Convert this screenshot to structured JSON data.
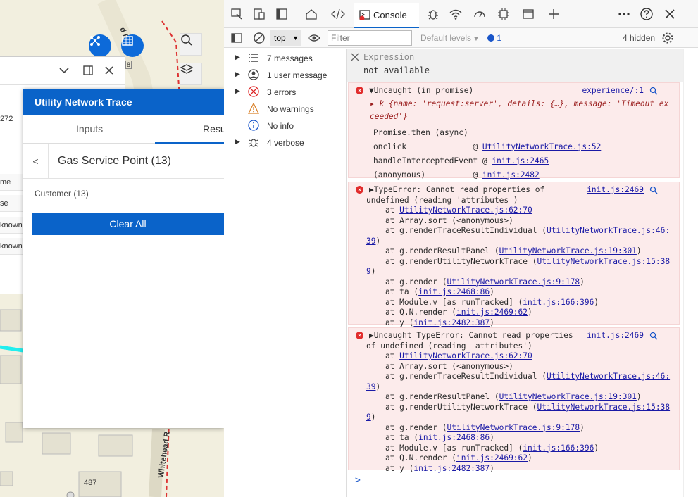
{
  "map": {
    "road_label": "d Rd",
    "road_label2": "Whitehead R",
    "parcel_label": "487",
    "house_num": "8",
    "panel_cells": [
      "272",
      "me",
      "se",
      "known",
      "known"
    ]
  },
  "trace_panel": {
    "title": "Utility Network Trace",
    "tabs": [
      "Inputs",
      "Resu"
    ],
    "back_label": "<",
    "group_title": "Gas Service Point (13)",
    "customer_label": "Customer (13)",
    "clear_all": "Clear All"
  },
  "devtools": {
    "console_tab_label": "Console",
    "context_select": "top",
    "filter_placeholder": "Filter",
    "levels": "Default levels",
    "issues_count": "1",
    "hidden": "4 hidden",
    "sidebar": [
      {
        "icon": "list-icon",
        "label": "7 messages",
        "expander": true
      },
      {
        "icon": "user-icon",
        "label": "1 user message",
        "expander": true
      },
      {
        "icon": "error-icon",
        "label": "3 errors",
        "expander": true
      },
      {
        "icon": "warning-icon",
        "label": "No warnings",
        "expander": false
      },
      {
        "icon": "info-icon",
        "label": "No info",
        "expander": false
      },
      {
        "icon": "bug-icon",
        "label": "4 verbose",
        "expander": true
      }
    ],
    "expression": {
      "label": "Expression",
      "value": "not available"
    },
    "errors": [
      {
        "lines": [
          {
            "t": "▼Uncaught (in promise)",
            "src": "experience/:1"
          },
          {
            "t": "▸ k {name: 'request:server', details: {…}, message: 'Timeout ex",
            "it": true
          },
          {
            "t": "ceeded'}",
            "it": true
          },
          {
            "t": "Promise.then (async)"
          },
          {
            "t": "onclick              @ ",
            "link": "UtilityNetworkTrace.js:52"
          },
          {
            "t": "handleInterceptedEvent @ ",
            "link": "init.js:2465"
          },
          {
            "t": "(anonymous)          @ ",
            "link": "init.js:2482"
          }
        ]
      },
      {
        "lines": [
          {
            "t": "▶TypeError: Cannot read properties of",
            "src": "init.js:2469"
          },
          {
            "t": "undefined (reading 'attributes')"
          },
          {
            "t": "    at ",
            "link": "UtilityNetworkTrace.js:62:70"
          },
          {
            "t": "    at Array.sort (<anonymous>)"
          },
          {
            "t": "    at g.renderTraceResultIndividual (",
            "link": "UtilityNetworkTrace.js:46:"
          },
          {
            "t": "",
            "link": "39",
            "tail": ")"
          },
          {
            "t": "    at g.renderResultPanel (",
            "link": "UtilityNetworkTrace.js:19:301",
            "tail": ")"
          },
          {
            "t": "    at g.renderUtilityNetworkTrace (",
            "link": "UtilityNetworkTrace.js:15:38"
          },
          {
            "t": "",
            "link": "9",
            "tail": ")"
          },
          {
            "t": "    at g.render (",
            "link": "UtilityNetworkTrace.js:9:178",
            "tail": ")"
          },
          {
            "t": "    at ta (",
            "link": "init.js:2468:86",
            "tail": ")"
          },
          {
            "t": "    at Module.v [as runTracked] (",
            "link": "init.js:166:396",
            "tail": ")"
          },
          {
            "t": "    at Q.N.render (",
            "link": "init.js:2469:62",
            "tail": ")"
          },
          {
            "t": "    at y (",
            "link": "init.js:2482:387",
            "tail": ")"
          }
        ]
      },
      {
        "lines": [
          {
            "t": "▶Uncaught TypeError: Cannot read properties",
            "src": "init.js:2469"
          },
          {
            "t": "of undefined (reading 'attributes')"
          },
          {
            "t": "    at ",
            "link": "UtilityNetworkTrace.js:62:70"
          },
          {
            "t": "    at Array.sort (<anonymous>)"
          },
          {
            "t": "    at g.renderTraceResultIndividual (",
            "link": "UtilityNetworkTrace.js:46:"
          },
          {
            "t": "",
            "link": "39",
            "tail": ")"
          },
          {
            "t": "    at g.renderResultPanel (",
            "link": "UtilityNetworkTrace.js:19:301",
            "tail": ")"
          },
          {
            "t": "    at g.renderUtilityNetworkTrace (",
            "link": "UtilityNetworkTrace.js:15:38"
          },
          {
            "t": "",
            "link": "9",
            "tail": ")"
          },
          {
            "t": "    at g.render (",
            "link": "UtilityNetworkTrace.js:9:178",
            "tail": ")"
          },
          {
            "t": "    at ta (",
            "link": "init.js:2468:86",
            "tail": ")"
          },
          {
            "t": "    at Module.v [as runTracked] (",
            "link": "init.js:166:396",
            "tail": ")"
          },
          {
            "t": "    at Q.N.render (",
            "link": "init.js:2469:62",
            "tail": ")"
          },
          {
            "t": "    at y (",
            "link": "init.js:2482:387",
            "tail": ")"
          }
        ]
      }
    ],
    "prompt": ">"
  }
}
